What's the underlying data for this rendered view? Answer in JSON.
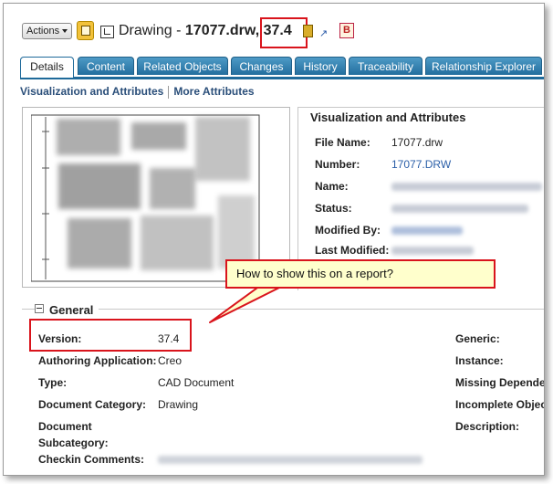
{
  "header": {
    "actions_label": "Actions",
    "title_prefix": "Drawing - ",
    "title_name": "17077.drw",
    "title_sep": ", ",
    "title_version": "37.4",
    "b_icon_label": "B"
  },
  "tabs": [
    {
      "label": "Details",
      "active": true
    },
    {
      "label": "Content"
    },
    {
      "label": "Related Objects"
    },
    {
      "label": "Changes"
    },
    {
      "label": "History"
    },
    {
      "label": "Traceability"
    },
    {
      "label": "Relationship Explorer"
    }
  ],
  "sublinks": {
    "visualization": "Visualization and Attributes",
    "more": "More Attributes"
  },
  "visualization_panel": {
    "title": "Visualization and Attributes",
    "file_name_label": "File Name:",
    "file_name_value": "17077.drw",
    "number_label": "Number:",
    "number_value": "17077.DRW",
    "name_label": "Name:",
    "status_label": "Status:",
    "modified_by_label": "Modified By:",
    "last_modified_label": "Last Modified:"
  },
  "callout": {
    "text": "How to show this on a report?"
  },
  "general": {
    "title": "General",
    "version_label": "Version:",
    "version_value": "37.4",
    "authoring_label": "Authoring Application:",
    "authoring_value": "Creo",
    "type_label": "Type:",
    "type_value": "CAD Document",
    "category_label": "Document Category:",
    "category_value": "Drawing",
    "subcategory_label_1": "Document",
    "subcategory_label_2": "Subcategory:",
    "checkin_label": "Checkin Comments:",
    "generic_label": "Generic:",
    "instance_label": "Instance:",
    "missing_label": "Missing Depende",
    "incomplete_label": "Incomplete Objec",
    "description_label": "Description:"
  },
  "colors": {
    "tab_blue": "#236e9e",
    "highlight_red": "#d9141c",
    "callout_bg": "#ffffcc",
    "link_blue": "#2b5fa8"
  }
}
